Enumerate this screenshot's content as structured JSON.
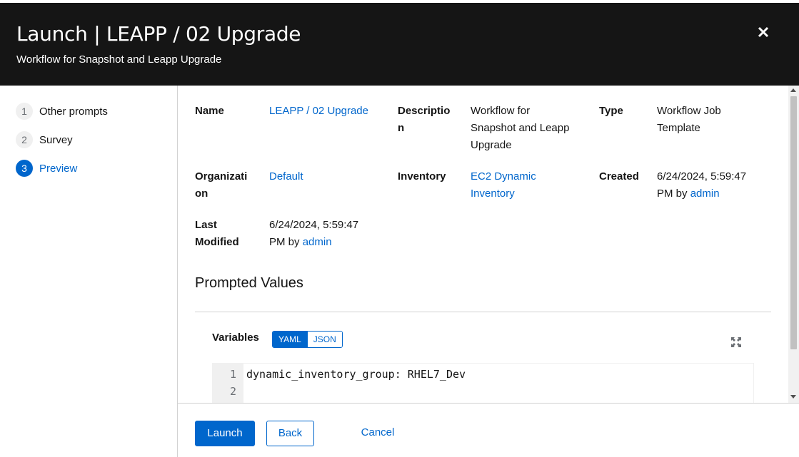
{
  "header": {
    "title": "Launch | LEAPP / 02 Upgrade",
    "subtitle": "Workflow for Snapshot and Leapp Upgrade",
    "close_icon": "close-icon"
  },
  "wizard_steps": [
    {
      "number": "1",
      "label": "Other prompts"
    },
    {
      "number": "2",
      "label": "Survey"
    },
    {
      "number": "3",
      "label": "Preview",
      "current": true
    }
  ],
  "details": {
    "name_label": "Name",
    "name_value": "LEAPP / 02 Upgrade",
    "description_label_line1": "Descriptio",
    "description_label_line2": "n",
    "description_line1": "Workflow for",
    "description_line2": "Snapshot and Leapp",
    "description_line3": "Upgrade",
    "type_label": "Type",
    "type_line1": "Workflow Job",
    "type_line2": "Template",
    "organization_label_line1": "Organizati",
    "organization_label_line2": "on",
    "organization_value": "Default",
    "inventory_label": "Inventory",
    "inventory_line1": "EC2 Dynamic",
    "inventory_line2": "Inventory",
    "created_label": "Created",
    "created_line1": "6/24/2024, 5:59:47",
    "created_line2_prefix": "PM by ",
    "created_by": "admin",
    "last_modified_label_line1": "Last",
    "last_modified_label_line2": "Modified",
    "modified_line1": "6/24/2024, 5:59:47",
    "modified_line2_prefix": "PM by ",
    "modified_by": "admin"
  },
  "prompted_values": {
    "title": "Prompted Values",
    "variables_label": "Variables",
    "toggle": {
      "yaml": "YAML",
      "json": "JSON",
      "selected": "YAML"
    },
    "expand_icon": "expand-icon",
    "line_numbers": [
      "1",
      "2"
    ],
    "code_lines": [
      "dynamic_inventory_group: RHEL7_Dev",
      ""
    ]
  },
  "footer": {
    "launch_label": "Launch",
    "back_label": "Back",
    "cancel_label": "Cancel"
  },
  "colors": {
    "header_bg": "#151515",
    "accent": "#0066cc",
    "border": "#d2d2d2"
  }
}
